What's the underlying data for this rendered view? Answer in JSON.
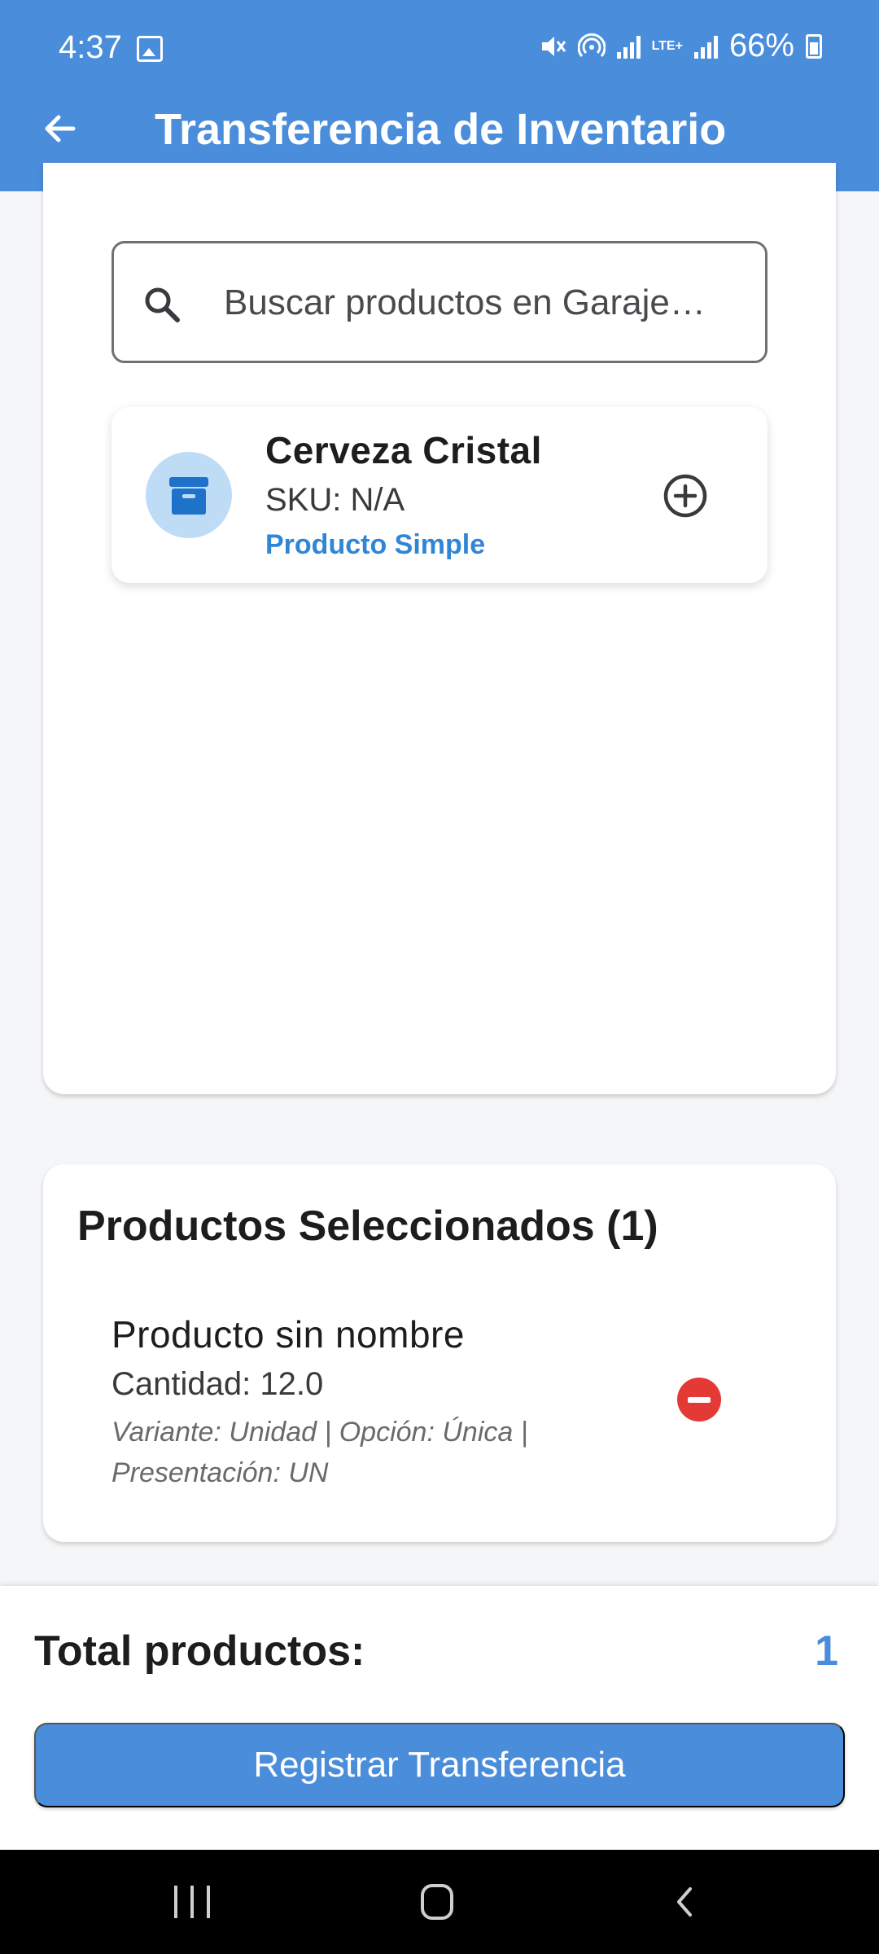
{
  "status_bar": {
    "time": "4:37",
    "battery": "66%",
    "network": "LTE+",
    "icons": [
      "gallery-icon",
      "mute-icon",
      "hotspot-icon",
      "signal-icon",
      "lte-icon",
      "signal-icon",
      "battery-icon"
    ]
  },
  "app_bar": {
    "title": "Transferencia de Inventario",
    "back_icon": "arrow-left-icon"
  },
  "search": {
    "placeholder": "Buscar productos en Garaje…",
    "value": "",
    "icon": "search-icon"
  },
  "results": [
    {
      "name": "Cerveza Cristal",
      "sku": "SKU: N/A",
      "type": "Producto Simple",
      "icon": "archive-box-icon",
      "action_icon": "add-circle-icon"
    }
  ],
  "selected": {
    "title": "Productos Seleccionados (1)",
    "items": [
      {
        "name": "Producto sin nombre",
        "quantity": "Cantidad: 12.0",
        "detail": "Variante: Unidad | Opción: Única | Presentación: UN",
        "action_icon": "remove-circle-icon"
      }
    ]
  },
  "footer": {
    "total_label": "Total productos:",
    "total_value": "1",
    "register_label": "Registrar Transferencia"
  },
  "colors": {
    "primary": "#4a8ddb",
    "accent_text": "#2f86d6",
    "danger": "#e53935",
    "avatar_bg": "#bfdcf6",
    "icon_blue": "#1f72c9"
  }
}
